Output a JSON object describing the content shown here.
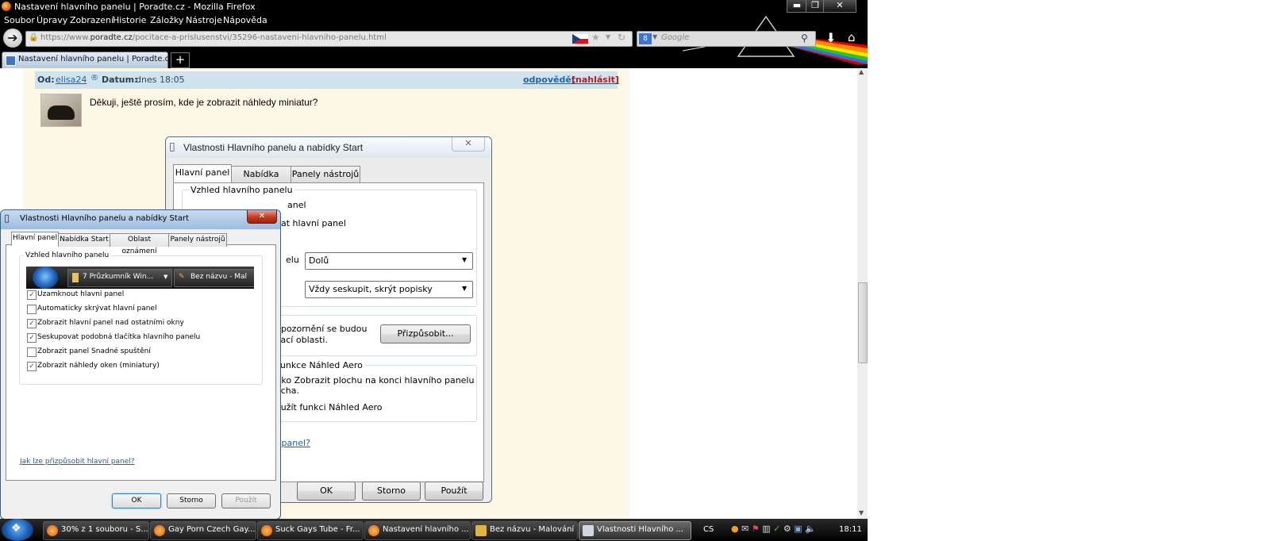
{
  "window": {
    "title": "Nastavení hlavního panelu | Poradte.cz - Mozilla Firefox"
  },
  "menu": [
    "Soubor",
    "Úpravy",
    "Zobrazení",
    "Historie",
    "Záložky",
    "Nástroje",
    "Nápověda"
  ],
  "url": {
    "prefix": "https://www.",
    "domain": "poradte.cz",
    "path": "/pocitace-a-prislusenstvi/35296-nastaveni-hlavniho-panelu.html"
  },
  "search": {
    "placeholder": "Google"
  },
  "tab": {
    "label": "Nastavení hlavního panelu | Poradte.cz",
    "new": "+"
  },
  "post": {
    "from_label": "Od:",
    "author": "elisa24",
    "date_label": "Datum:",
    "date": "dnes 18:05",
    "reply": "odpovědět",
    "report": "[nahlásit]",
    "body": "Děkuji, ještě prosím, kde je zobrazit náhledy miniatur?"
  },
  "win7dialog": {
    "title": "Vlastnosti Hlavního panelu a nabídky Start",
    "tabs": [
      "Hlavní panel",
      "Nabídka Start",
      "Panely nástrojů"
    ],
    "group1": "Vzhled hlavního panelu",
    "frag1": "anel",
    "frag2": "at hlavní panel",
    "frag3": "elu",
    "combo1": "Dolů",
    "combo2": "Vždy seskupit, skrýt popisky",
    "frag4": "upozornění se budou",
    "frag5": "vací oblasti.",
    "customize": "Přizpůsobit...",
    "group3": "funkce Náhled Aero",
    "frag6": "ítko Zobrazit plochu na konci hlavního panelu",
    "frag7": "ocha.",
    "frag8": "oužít funkci Náhled Aero",
    "link": "í panel?",
    "ok": "OK",
    "cancel": "Storno",
    "apply": "Použít"
  },
  "vistadialog": {
    "title": "Vlastnosti Hlavního panelu a nabídky Start",
    "tabs": [
      "Hlavní panel",
      "Nabídka Start",
      "Oblast oznámení",
      "Panely nástrojů"
    ],
    "group": "Vzhled hlavního panelu",
    "preview_btn1": "7 Průzkumník Win...",
    "preview_btn2": "Bez názvu - Mal",
    "options": [
      {
        "label": "Uzamknout hlavní panel",
        "checked": true
      },
      {
        "label": "Automaticky skrývat hlavní panel",
        "checked": false
      },
      {
        "label": "Zobrazit hlavní panel nad ostatními okny",
        "checked": true
      },
      {
        "label": "Seskupovat podobná tlačítka hlavního panelu",
        "checked": true
      },
      {
        "label": "Zobrazit panel Snadné spuštění",
        "checked": false
      },
      {
        "label": "Zobrazit náhledy oken (miniatury)",
        "checked": true
      }
    ],
    "link": "Jak lze přizpůsobit hlavní panel?",
    "ok": "OK",
    "cancel": "Storno",
    "apply": "Použít"
  },
  "taskbar": {
    "items": [
      "30% z 1 souboru - S...",
      "Gay Porn Czech Gay...",
      "Suck Gays Tube - Fr...",
      "Nastavení hlavního ...",
      "Bez názvu - Malování",
      "Vlastnosti Hlavního ..."
    ],
    "lang": "CS",
    "time": "18:11"
  }
}
